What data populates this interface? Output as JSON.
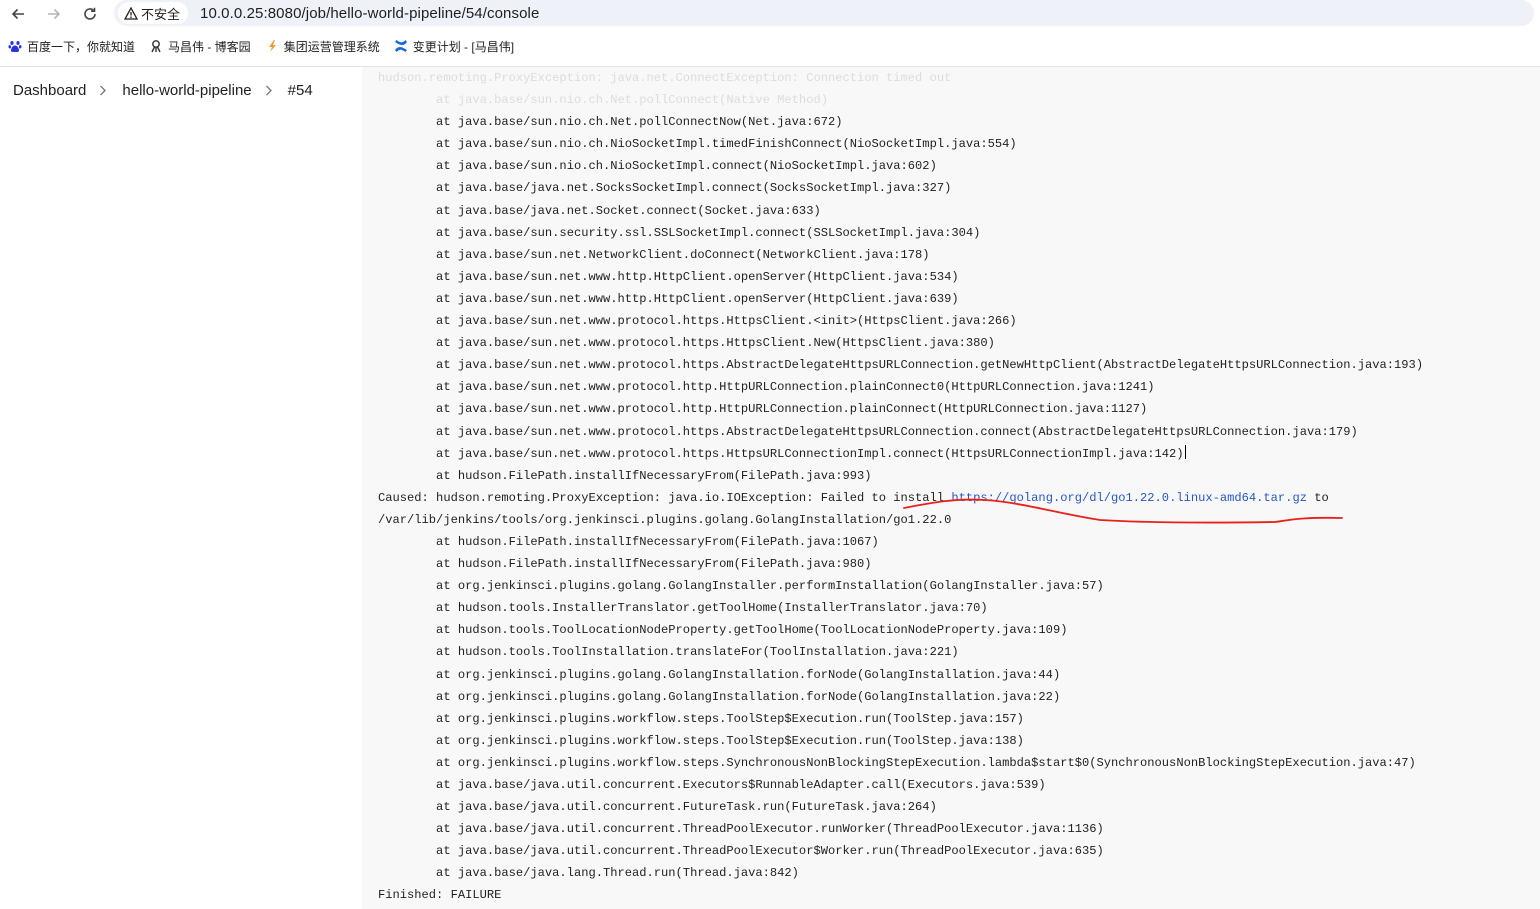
{
  "browser": {
    "security_label": "不安全",
    "url": "10.0.0.25:8080/job/hello-world-pipeline/54/console",
    "bookmarks": [
      {
        "label": "百度一下，你就知道",
        "icon": "baidu-paw-icon"
      },
      {
        "label": "马昌伟 - 博客园",
        "icon": "cnblogs-icon"
      },
      {
        "label": "集团运营管理系统",
        "icon": "ops-system-icon"
      },
      {
        "label": "变更计划 - [马昌伟]",
        "icon": "confluence-icon"
      }
    ]
  },
  "breadcrumb": {
    "dashboard": "Dashboard",
    "job": "hello-world-pipeline",
    "build": "#54"
  },
  "console": {
    "faded_lines": [
      "hudson.remoting.ProxyException: java.net.ConnectException: Connection timed out",
      "        at java.base/sun.nio.ch.Net.pollConnect(Native Method)"
    ],
    "lines_before_cause": [
      "        at java.base/sun.nio.ch.Net.pollConnectNow(Net.java:672)",
      "        at java.base/sun.nio.ch.NioSocketImpl.timedFinishConnect(NioSocketImpl.java:554)",
      "        at java.base/sun.nio.ch.NioSocketImpl.connect(NioSocketImpl.java:602)",
      "        at java.base/java.net.SocksSocketImpl.connect(SocksSocketImpl.java:327)",
      "        at java.base/java.net.Socket.connect(Socket.java:633)",
      "        at java.base/sun.security.ssl.SSLSocketImpl.connect(SSLSocketImpl.java:304)",
      "        at java.base/sun.net.NetworkClient.doConnect(NetworkClient.java:178)",
      "        at java.base/sun.net.www.http.HttpClient.openServer(HttpClient.java:534)",
      "        at java.base/sun.net.www.http.HttpClient.openServer(HttpClient.java:639)",
      "        at java.base/sun.net.www.protocol.https.HttpsClient.<init>(HttpsClient.java:266)",
      "        at java.base/sun.net.www.protocol.https.HttpsClient.New(HttpsClient.java:380)",
      "        at java.base/sun.net.www.protocol.https.AbstractDelegateHttpsURLConnection.getNewHttpClient(AbstractDelegateHttpsURLConnection.java:193)",
      "        at java.base/sun.net.www.protocol.http.HttpURLConnection.plainConnect0(HttpURLConnection.java:1241)",
      "        at java.base/sun.net.www.protocol.http.HttpURLConnection.plainConnect(HttpURLConnection.java:1127)",
      "        at java.base/sun.net.www.protocol.https.AbstractDelegateHttpsURLConnection.connect(AbstractDelegateHttpsURLConnection.java:179)",
      "        at java.base/sun.net.www.protocol.https.HttpsURLConnectionImpl.connect(HttpsURLConnectionImpl.java:142)",
      "        at hudson.FilePath.installIfNecessaryFrom(FilePath.java:993)"
    ],
    "caused_prefix": "Caused: hudson.remoting.ProxyException: java.io.IOException: Failed to install ",
    "caused_link": "https://golang.org/dl/go1.22.0.linux-amd64.tar.gz",
    "caused_suffix": " to",
    "caused_path": "/var/lib/jenkins/tools/org.jenkinsci.plugins.golang.GolangInstallation/go1.22.0",
    "lines_after_cause": [
      "        at hudson.FilePath.installIfNecessaryFrom(FilePath.java:1067)",
      "        at hudson.FilePath.installIfNecessaryFrom(FilePath.java:980)",
      "        at org.jenkinsci.plugins.golang.GolangInstaller.performInstallation(GolangInstaller.java:57)",
      "        at hudson.tools.InstallerTranslator.getToolHome(InstallerTranslator.java:70)",
      "        at hudson.tools.ToolLocationNodeProperty.getToolHome(ToolLocationNodeProperty.java:109)",
      "        at hudson.tools.ToolInstallation.translateFor(ToolInstallation.java:221)",
      "        at org.jenkinsci.plugins.golang.GolangInstallation.forNode(GolangInstallation.java:44)",
      "        at org.jenkinsci.plugins.golang.GolangInstallation.forNode(GolangInstallation.java:22)",
      "        at org.jenkinsci.plugins.workflow.steps.ToolStep$Execution.run(ToolStep.java:157)",
      "        at org.jenkinsci.plugins.workflow.steps.ToolStep$Execution.run(ToolStep.java:138)",
      "        at org.jenkinsci.plugins.workflow.steps.SynchronousNonBlockingStepExecution.lambda$start$0(SynchronousNonBlockingStepExecution.java:47)",
      "        at java.base/java.util.concurrent.Executors$RunnableAdapter.call(Executors.java:539)",
      "        at java.base/java.util.concurrent.FutureTask.run(FutureTask.java:264)",
      "        at java.base/java.util.concurrent.ThreadPoolExecutor.runWorker(ThreadPoolExecutor.java:1136)",
      "        at java.base/java.util.concurrent.ThreadPoolExecutor$Worker.run(ThreadPoolExecutor.java:635)",
      "        at java.base/java.lang.Thread.run(Thread.java:842)"
    ],
    "finished": "Finished: FAILURE",
    "link_color": "#2557c7",
    "annotation_color": "#e8211b"
  }
}
